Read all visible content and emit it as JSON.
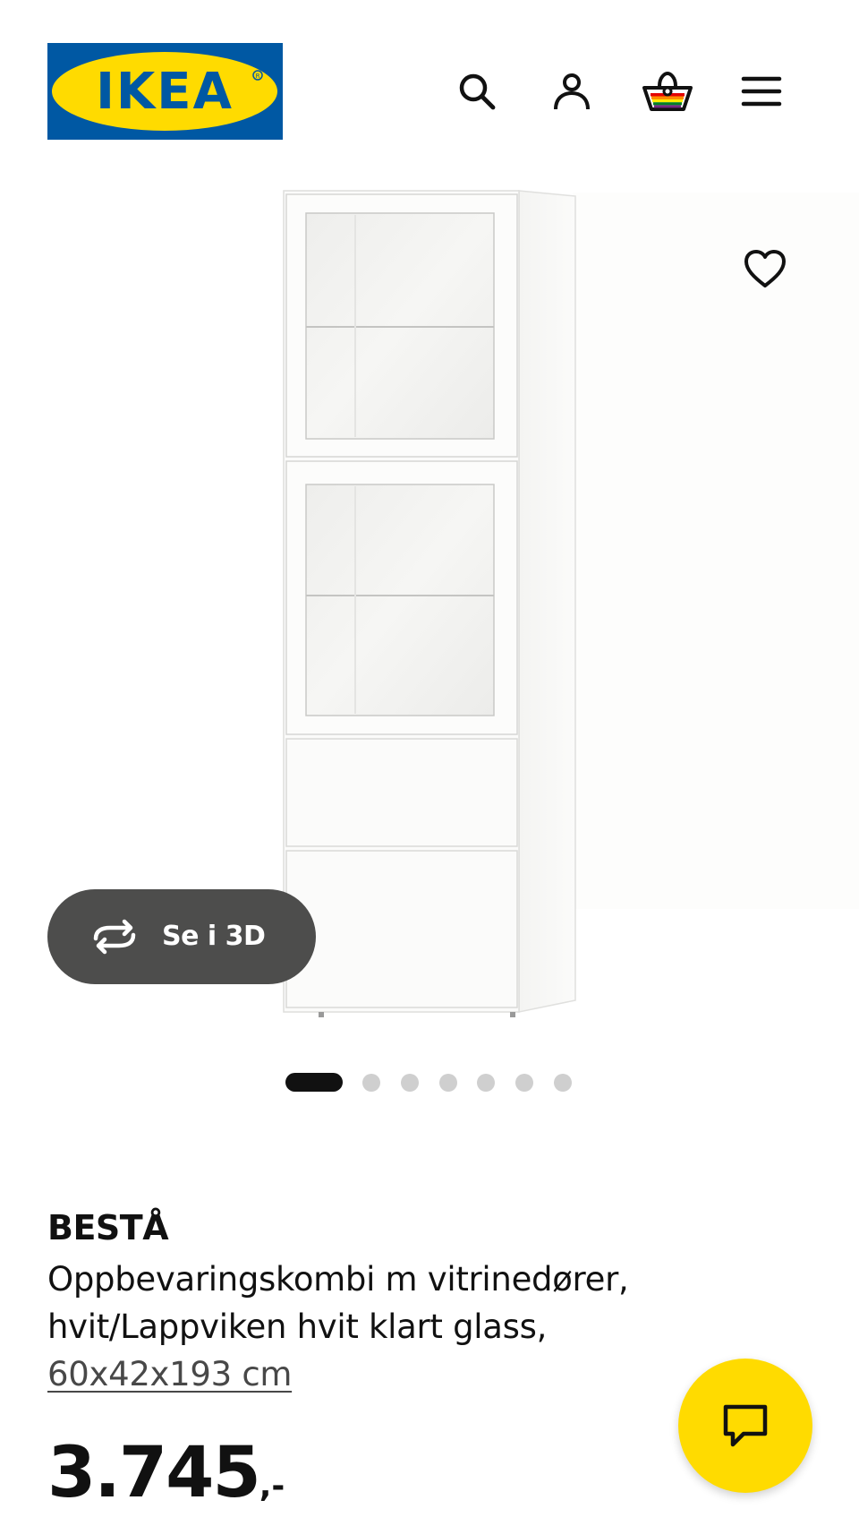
{
  "header": {
    "logo_text": "IKEA",
    "icons": [
      "search-icon",
      "account-icon",
      "cart-icon",
      "menu-icon"
    ]
  },
  "gallery": {
    "view_3d_label": "Se i 3D",
    "slide_count": 7,
    "active_slide": 1
  },
  "product": {
    "brand": "BESTÅ",
    "description_line1": "Oppbevaringskombi m vitrinedører,",
    "description_line2": "hvit/Lappviken hvit klart glass,",
    "size": "60x42x193 cm",
    "price": "3.745",
    "price_suffix": ",-"
  },
  "colors": {
    "ikea_blue": "#0058a3",
    "ikea_yellow": "#ffdb00",
    "button_dark": "#4d4d4c"
  }
}
